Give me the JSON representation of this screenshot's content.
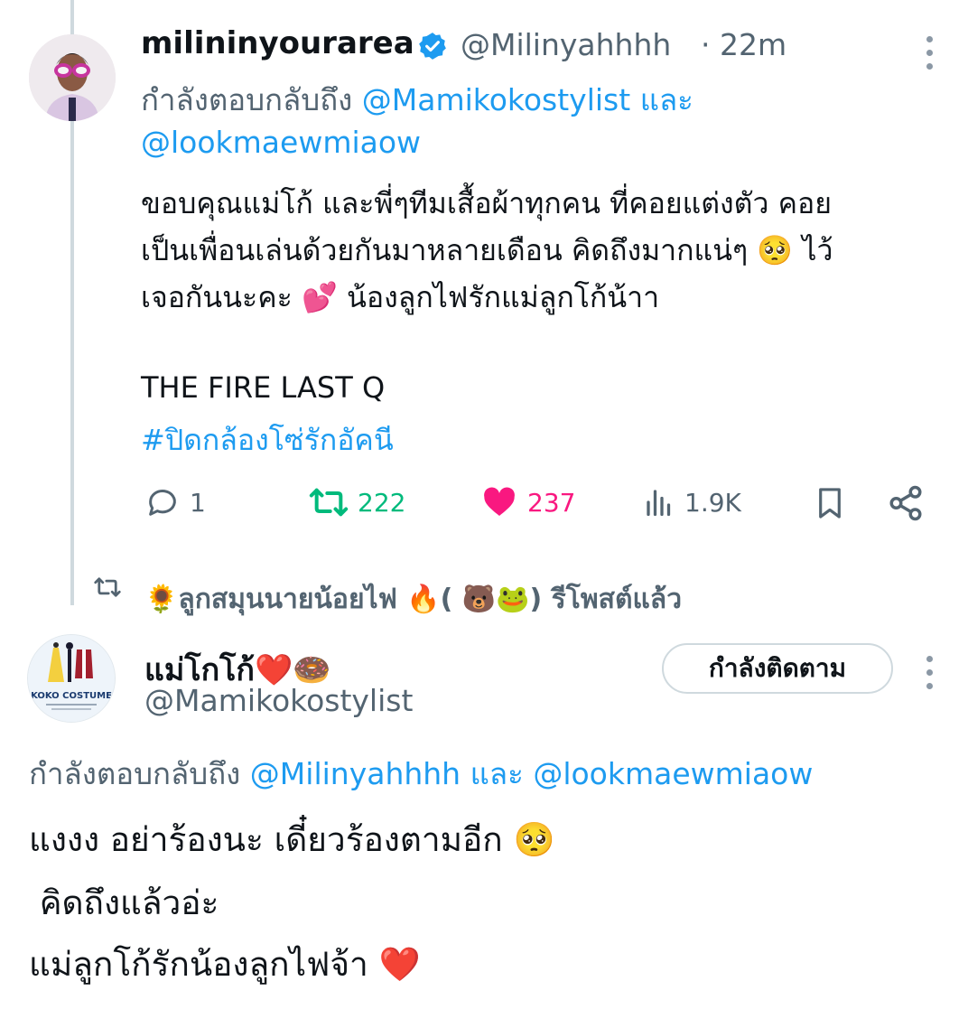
{
  "reply_tweet": {
    "display_name": "milininyourarea",
    "handle": "@Milinyahhhh",
    "time": "· 22m",
    "replying_prefix": "กำลังตอบกลับถึง",
    "replying_user_1": "@Mamikokostylist",
    "replying_conj": "และ",
    "replying_user_2": "@lookmaewmiaow",
    "body_line_1": "ขอบคุณแม่โก้ และพี่ๆทีมเสื้อผ้าทุกคน ที่คอยแต่งตัว คอย",
    "body_line_2": "เป็นเพื่อนเล่นด้วยกันมาหลายเดือน คิดถึงมากแน่ๆ 🥺 ไว้",
    "body_line_3": "เจอกันนะคะ 💕 น้องลูกไฟรักแม่ลูกโก้น้าา",
    "body_line_4": "THE FIRE LAST Q",
    "hashtag": "#ปิดกล้องโซ่รักอัคนี",
    "stats": {
      "replies": "1",
      "retweets": "222",
      "likes": "237",
      "views": "1.9K"
    }
  },
  "repost_notice": {
    "text": "🌻ลูกสมุนนายน้อยไฟ 🔥( 🐻🐸) รีโพสต์แล้ว"
  },
  "main_tweet": {
    "display_name": "แม่โกโก้❤️🍩",
    "handle": "@Mamikokostylist",
    "avatar_text": "KOKO COSTUME",
    "follow_label": "กำลังติดตาม",
    "replying_prefix": "กำลังตอบกลับถึง",
    "replying_user_1": "@Milinyahhhh",
    "replying_conj": "และ",
    "replying_user_2": "@lookmaewmiaow",
    "body_line_1": "แงงง อย่าร้องนะ เดี๋ยวร้องตามอีก 🥺",
    "body_line_2": " คิดถึงแล้วอ่ะ",
    "body_line_3": "แม่ลูกโก้รักน้องลูกไฟจ้า ❤️"
  },
  "colors": {
    "link": "#1d9bf0",
    "muted": "#536471",
    "retweet_green": "#00ba7c",
    "like_pink": "#f91880",
    "verified_blue": "#1d9bf0"
  }
}
